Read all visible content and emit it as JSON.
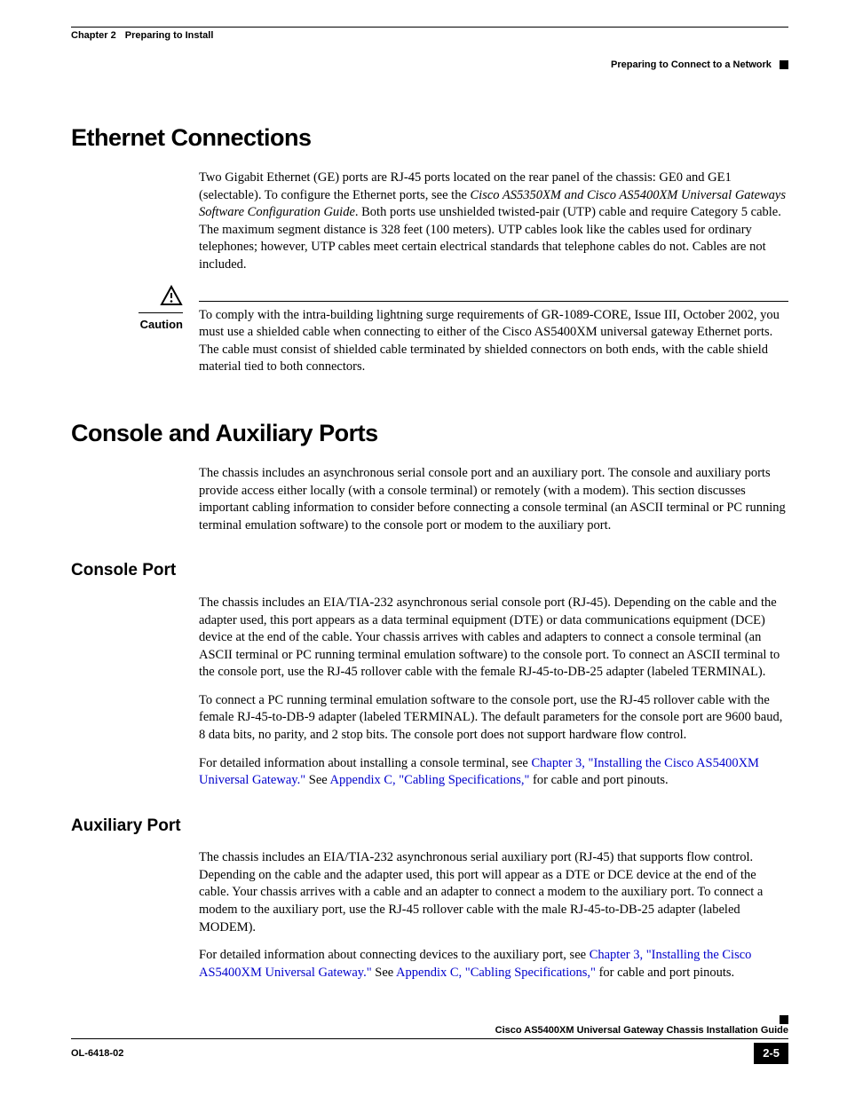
{
  "header": {
    "chapter_label": "Chapter 2",
    "chapter_title": "Preparing to Install",
    "section_right": "Preparing to Connect to a Network"
  },
  "sections": {
    "ethernet": {
      "title": "Ethernet Connections",
      "p1_a": "Two Gigabit Ethernet (GE) ports are RJ-45 ports located on the rear panel of the chassis: GE0 and GE1 (selectable). To configure the Ethernet ports, see the ",
      "p1_i": "Cisco AS5350XM and Cisco AS5400XM Universal Gateways Software Configuration Guide",
      "p1_b": ". Both ports use unshielded twisted-pair (UTP) cable and require Category 5 cable. The maximum segment distance is 328 feet (100 meters). UTP cables look like the cables used for ordinary telephones; however, UTP cables meet certain electrical standards that telephone cables do not. Cables are not included.",
      "caution_label": "Caution",
      "caution_text": "To comply with the intra-building lightning surge requirements of GR-1089-CORE, Issue III, October 2002, you must use a shielded cable when connecting to either of the Cisco AS5400XM universal gateway Ethernet ports. The cable must consist of shielded cable terminated by shielded connectors on both ends, with the cable shield material tied to both connectors."
    },
    "console_aux": {
      "title": "Console and Auxiliary Ports",
      "intro": "The chassis includes an asynchronous serial console port and an auxiliary port. The console and auxiliary ports provide access either locally (with a console terminal) or remotely (with a modem). This section discusses important cabling information to consider before connecting a console terminal (an ASCII terminal or PC running terminal emulation software) to the console port or modem to the auxiliary port.",
      "console": {
        "title": "Console Port",
        "p1": "The chassis includes an EIA/TIA-232 asynchronous serial console port (RJ-45). Depending on the cable and the adapter used, this port appears as a data terminal equipment (DTE) or data communications equipment (DCE) device at the end of the cable. Your chassis arrives with cables and adapters to connect a console terminal (an ASCII terminal or PC running terminal emulation software) to the console port. To connect an ASCII terminal to the console port, use the RJ-45 rollover cable with the female RJ-45-to-DB-25 adapter (labeled TERMINAL).",
        "p2": "To connect a PC running terminal emulation software to the console port, use the RJ-45 rollover cable with the female RJ-45-to-DB-9 adapter (labeled TERMINAL). The default parameters for the console port are 9600 baud, 8 data bits, no parity, and 2 stop bits. The console port does not support hardware flow control.",
        "p3_a": "For detailed information about installing a console terminal, see ",
        "p3_link1": "Chapter 3, \"Installing the Cisco AS5400XM Universal Gateway.\"",
        "p3_b": " See ",
        "p3_link2": "Appendix C, \"Cabling Specifications,\"",
        "p3_c": " for cable and port pinouts."
      },
      "aux": {
        "title": "Auxiliary Port",
        "p1": "The chassis includes an EIA/TIA-232 asynchronous serial auxiliary port (RJ-45) that supports flow control. Depending on the cable and the adapter used, this port will appear as a DTE or DCE device at the end of the cable. Your chassis arrives with a cable and an adapter to connect a modem to the auxiliary port. To connect a modem to the auxiliary port, use the RJ-45 rollover cable with the male RJ-45-to-DB-25 adapter (labeled MODEM).",
        "p2_a": "For detailed information about connecting devices to the auxiliary port, see ",
        "p2_link1": "Chapter 3, \"Installing the Cisco AS5400XM Universal Gateway.\"",
        "p2_b": " See ",
        "p2_link2": "Appendix C, \"Cabling Specifications,\"",
        "p2_c": " for cable and port pinouts."
      }
    }
  },
  "footer": {
    "doc_title": "Cisco AS5400XM Universal Gateway Chassis Installation Guide",
    "doc_num": "OL-6418-02",
    "page_num": "2-5"
  }
}
